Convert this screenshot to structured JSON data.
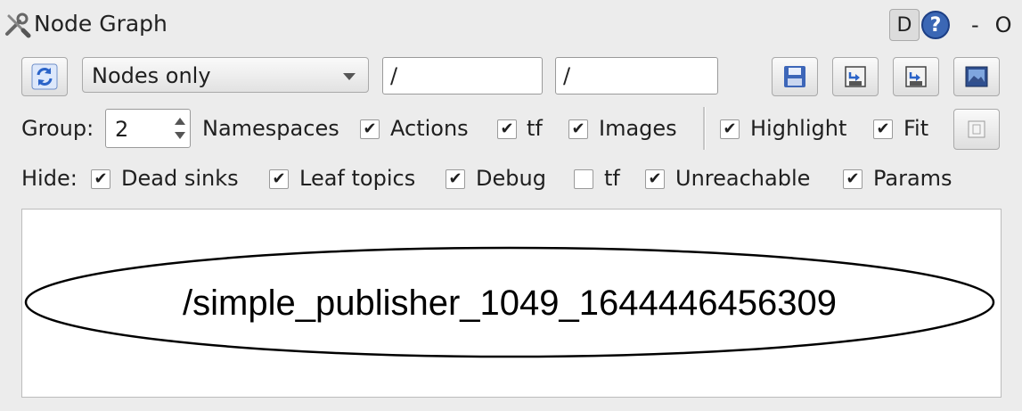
{
  "window": {
    "title": "Node Graph",
    "title_icon": "wrench-screwdriver-icon",
    "btn_d": "D",
    "btn_help": "?",
    "btn_minimize": "-",
    "btn_option": "O"
  },
  "toolbar": {
    "refresh_icon": "refresh-icon",
    "graph_type": {
      "selected": "Nodes only"
    },
    "filter_ns": "/",
    "filter_topic": "/",
    "load_icon": "load-dot-icon",
    "save_dot_icon": "save-dot-icon",
    "save_svg_icon": "save-svg-icon",
    "save_image_icon": "save-image-icon"
  },
  "options": {
    "group_label": "Group:",
    "group_value": "2",
    "namespaces_label": "Namespaces",
    "actions": {
      "label": "Actions",
      "checked": true
    },
    "tf": {
      "label": "tf",
      "checked": true
    },
    "images": {
      "label": "Images",
      "checked": true
    },
    "highlight": {
      "label": "Highlight",
      "checked": true
    },
    "fit": {
      "label": "Fit",
      "checked": true
    },
    "fit_icon": "fit-in-view-icon"
  },
  "hide": {
    "label": "Hide:",
    "dead_sinks": {
      "label": "Dead sinks",
      "checked": true
    },
    "leaf_topics": {
      "label": "Leaf topics",
      "checked": true
    },
    "debug": {
      "label": "Debug",
      "checked": true
    },
    "tf": {
      "label": "tf",
      "checked": false
    },
    "unreachable": {
      "label": "Unreachable",
      "checked": true
    },
    "params": {
      "label": "Params",
      "checked": true
    }
  },
  "graph": {
    "nodes": [
      {
        "label": "/simple_publisher_1049_1644446456309"
      }
    ]
  }
}
